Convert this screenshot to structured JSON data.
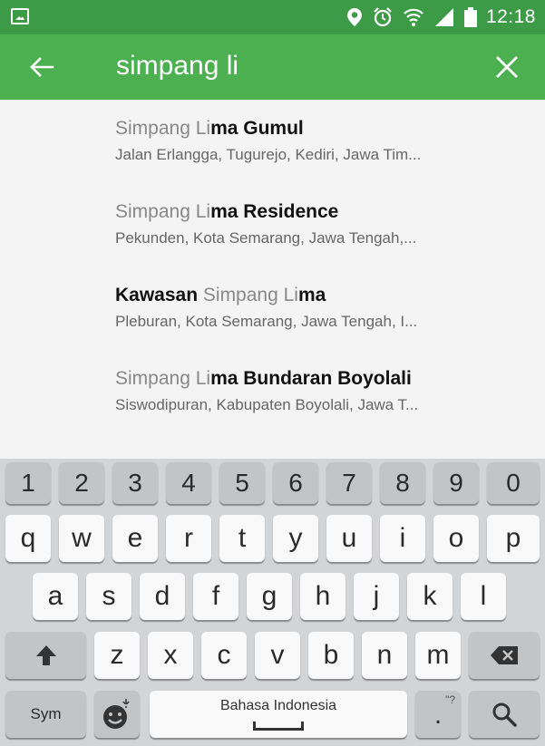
{
  "status_bar": {
    "time": "12:18",
    "icons": [
      "gallery-icon",
      "location-icon",
      "alarm-icon",
      "wifi-icon",
      "signal-icon",
      "battery-icon"
    ]
  },
  "app_bar": {
    "query": "simpang li",
    "back_icon": "arrow-left-icon",
    "clear_icon": "close-icon"
  },
  "results": [
    {
      "title_parts": [
        {
          "text": "Simpang ",
          "style": "m"
        },
        {
          "text": "Li",
          "style": "m"
        },
        {
          "text": "ma Gumul",
          "style": "b"
        }
      ],
      "subtitle": "Jalan Erlangga, Tugurejo, Kediri, Jawa Tim..."
    },
    {
      "title_parts": [
        {
          "text": "Simpang ",
          "style": "m"
        },
        {
          "text": "Li",
          "style": "m"
        },
        {
          "text": "ma Residence",
          "style": "b"
        }
      ],
      "subtitle": "Pekunden, Kota Semarang, Jawa Tengah,..."
    },
    {
      "title_parts": [
        {
          "text": "Kawasan ",
          "style": "b"
        },
        {
          "text": "Simpang ",
          "style": "m"
        },
        {
          "text": "Li",
          "style": "m"
        },
        {
          "text": "ma",
          "style": "b"
        }
      ],
      "subtitle": "Pleburan, Kota Semarang, Jawa Tengah, I..."
    },
    {
      "title_parts": [
        {
          "text": "Simpang ",
          "style": "m"
        },
        {
          "text": "Li",
          "style": "m"
        },
        {
          "text": "ma Bundaran Boyolali",
          "style": "b"
        }
      ],
      "subtitle": "Siswodipuran, Kabupaten Boyolali, Jawa T..."
    }
  ],
  "keyboard": {
    "numbers": [
      "1",
      "2",
      "3",
      "4",
      "5",
      "6",
      "7",
      "8",
      "9",
      "0"
    ],
    "row1": [
      "q",
      "w",
      "e",
      "r",
      "t",
      "y",
      "u",
      "i",
      "o",
      "p"
    ],
    "row2": [
      "a",
      "s",
      "d",
      "f",
      "g",
      "h",
      "j",
      "k",
      "l"
    ],
    "row3": [
      "z",
      "x",
      "c",
      "v",
      "b",
      "n",
      "m"
    ],
    "sym_label": "Sym",
    "space_label": "Bahasa Indonesia",
    "period_label": ".",
    "period_hint": "\"?",
    "shift_icon": "shift-arrow-icon",
    "backspace_icon": "backspace-icon",
    "emoji_icon": "emoji-mic-icon",
    "search_icon": "search-icon"
  }
}
